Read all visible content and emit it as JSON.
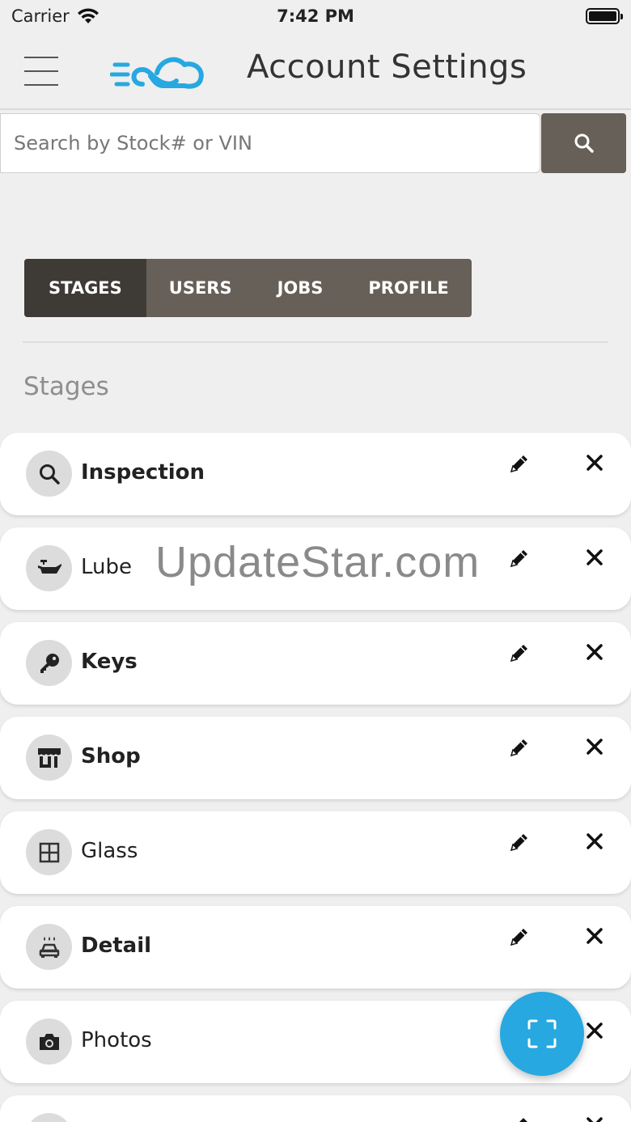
{
  "status_bar": {
    "carrier": "Carrier",
    "time": "7:42 PM",
    "battery_level": 1.0
  },
  "header": {
    "title": "Account Settings",
    "menu_icon": "hamburger-icon",
    "logo": "cloud-logo"
  },
  "search": {
    "placeholder": "Search by Stock# or VIN",
    "value": "",
    "button_icon": "search-icon"
  },
  "tabs": [
    {
      "label": "STAGES",
      "active": true
    },
    {
      "label": "USERS",
      "active": false
    },
    {
      "label": "JOBS",
      "active": false
    },
    {
      "label": "PROFILE",
      "active": false
    }
  ],
  "section_title": "Stages",
  "stages": [
    {
      "label": "Inspection",
      "icon": "magnifier-icon",
      "bold": true
    },
    {
      "label": "Lube",
      "icon": "oil-can-icon",
      "bold": false
    },
    {
      "label": "Keys",
      "icon": "key-icon",
      "bold": true
    },
    {
      "label": "Shop",
      "icon": "storefront-icon",
      "bold": true
    },
    {
      "label": "Glass",
      "icon": "window-icon",
      "bold": false
    },
    {
      "label": "Detail",
      "icon": "car-wash-icon",
      "bold": true
    },
    {
      "label": "Photos",
      "icon": "camera-icon",
      "bold": false
    },
    {
      "label": "",
      "icon": "",
      "bold": false
    }
  ],
  "watermark": "UpdateStar.com",
  "fab_icon": "scan-icon",
  "colors": {
    "accent": "#27a8e0",
    "tab_bg": "#676058",
    "tab_active": "#3e3b37",
    "page_bg": "#efefef"
  }
}
